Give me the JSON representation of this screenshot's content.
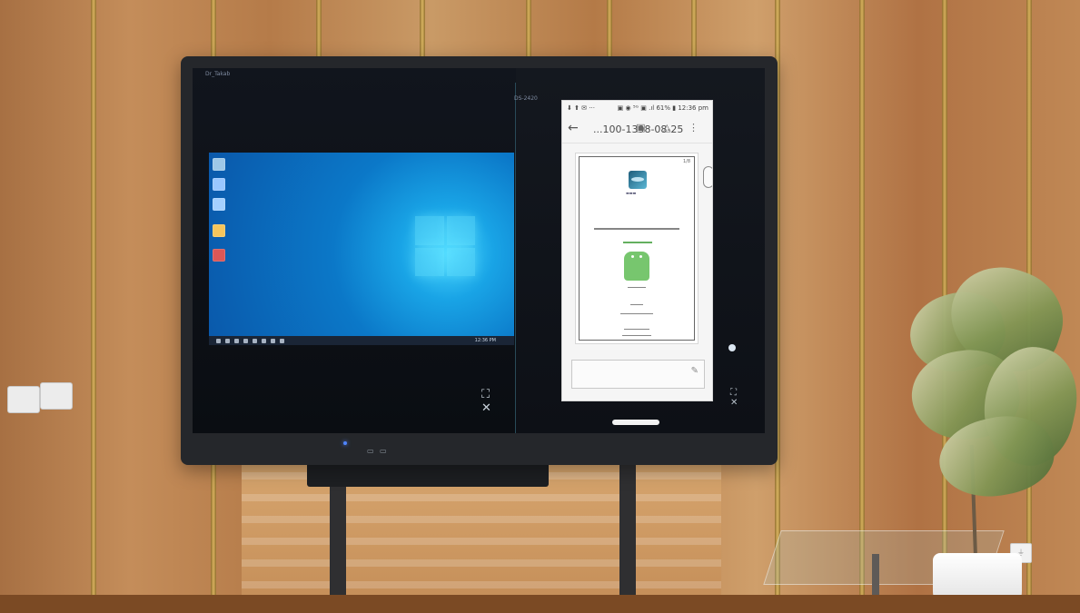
{
  "tv": {
    "left_label": "Dr_Takab",
    "center_label": "DS-2420",
    "left_controls": "⛶ ✕",
    "right_controls": "⛶ ✕"
  },
  "windows": {
    "tray_time": "12:36 PM"
  },
  "phone": {
    "status_left": "⬇ ⬆ ✉ ···",
    "status_right": "▣ ◉ ⁵ᴳ ▣ .ıl 61% ▮ 12:36 pm",
    "title": "...100-1398-08-25",
    "page_count": "1/8"
  },
  "colors": {
    "wall": "#b9834e",
    "screen": "#0e1016",
    "desktop_blue": "#0b78c8",
    "android_green": "#77c66e"
  },
  "icons": {
    "back": "back-arrow-icon",
    "search": "search-icon",
    "share": "share-icon",
    "more": "more-icon",
    "fullscreen": "fullscreen-icon",
    "close": "close-icon"
  }
}
